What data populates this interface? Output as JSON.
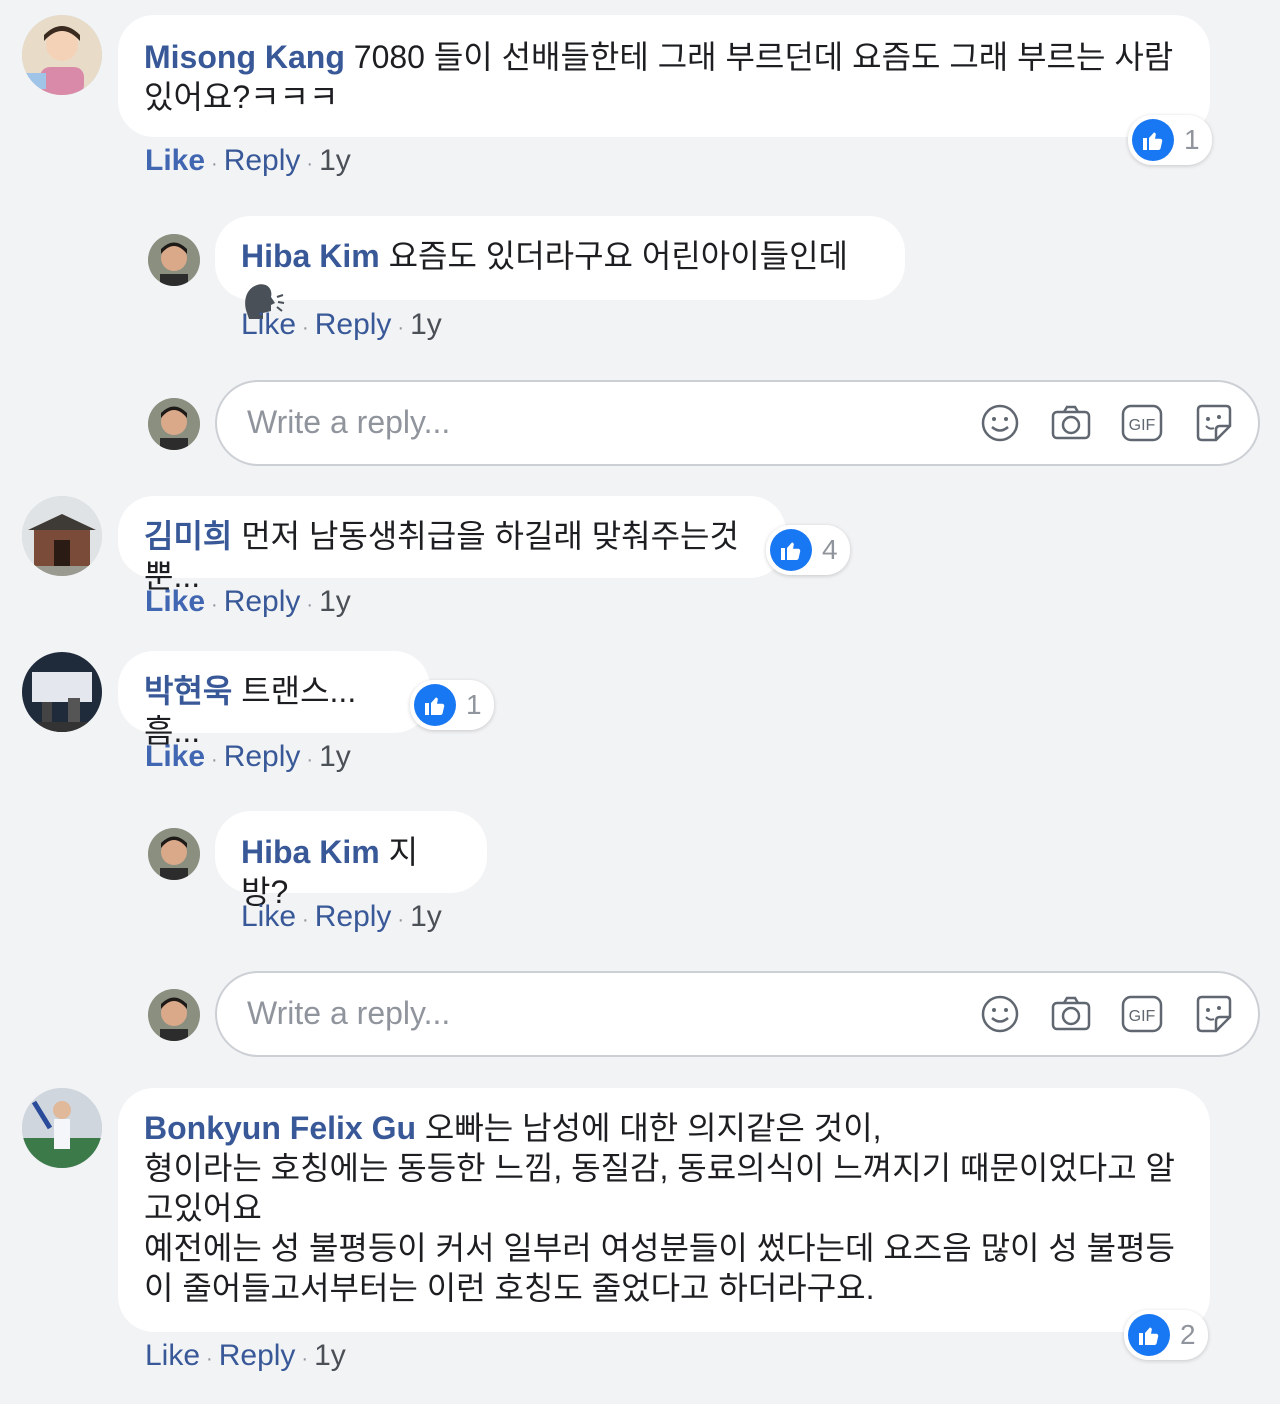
{
  "comments": [
    {
      "name": "Misong Kang",
      "text": "7080 들이 선배들한테 그래 부르던데 요즘도 그래 부르는 사람 있어요?ㅋㅋㅋ",
      "reactions": "1",
      "actions": {
        "like": "Like",
        "reply": "Reply",
        "time": "1y"
      }
    },
    {
      "name": "Hiba Kim",
      "text": "요즘도 있더라구요 어린아이들인데",
      "actions": {
        "like": "Like",
        "reply": "Reply",
        "time": "1y"
      }
    },
    {
      "name": "김미희",
      "text": "먼저 남동생취급을 하길래 맞춰주는것뿐...",
      "reactions": "4",
      "actions": {
        "like": "Like",
        "reply": "Reply",
        "time": "1y"
      }
    },
    {
      "name": "박현욱",
      "text": "트랜스... 흠...",
      "reactions": "1",
      "actions": {
        "like": "Like",
        "reply": "Reply",
        "time": "1y"
      }
    },
    {
      "name": "Hiba Kim",
      "text": "지방?",
      "actions": {
        "like": "Like",
        "reply": "Reply",
        "time": "1y"
      }
    },
    {
      "name": "Bonkyun Felix Gu",
      "text_line1": "오빠는 남성에 대한 의지같은 것이,",
      "text_rest": "형이라는 호칭에는 동등한 느낌, 동질감, 동료의식이 느껴지기 때문이었다고 알고있어요\n예전에는 성 불평등이 커서 일부러 여성분들이 썼다는데 요즈음 많이 성 불평등이 줄어들고서부터는 이런 호칭도 줄었다고 하더라구요.",
      "reactions": "2",
      "actions": {
        "like": "Like",
        "reply": "Reply",
        "time": "1y"
      }
    }
  ],
  "reply_box": {
    "placeholder": "Write a reply...",
    "tools": [
      "smiley-icon",
      "camera-icon",
      "gif-icon",
      "sticker-icon"
    ],
    "gif_label": "GIF"
  },
  "colors": {
    "background": "#f2f3f5",
    "name": "#385898",
    "like_blue": "#1877f2",
    "meta_gray": "#90949c"
  }
}
